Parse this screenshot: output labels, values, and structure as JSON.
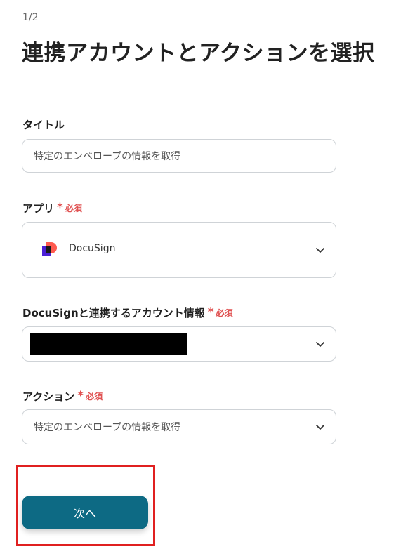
{
  "step": "1/2",
  "page_title": "連携アカウントとアクションを選択",
  "required_text": "必須",
  "required_star": "*",
  "title_field": {
    "label": "タイトル",
    "value": "特定のエンベロープの情報を取得"
  },
  "app_field": {
    "label": "アプリ",
    "value": "DocuSign",
    "icon": "docusign-logo"
  },
  "account_field": {
    "label": "DocuSignと連携するアカウント情報",
    "value": ""
  },
  "action_field": {
    "label": "アクション",
    "value": "特定のエンベロープの情報を取得"
  },
  "next_button": "次へ",
  "colors": {
    "primary": "#0d6a84",
    "required": "#e05252",
    "highlight": "#e02020"
  }
}
